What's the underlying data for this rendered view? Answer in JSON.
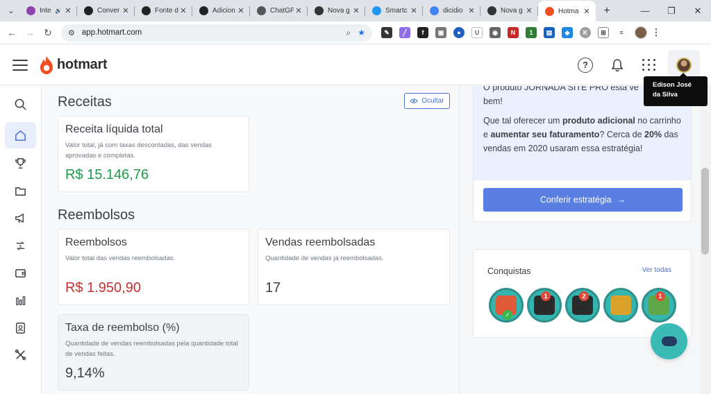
{
  "browser": {
    "tabs": [
      {
        "label": "Inte",
        "favicon": "heart",
        "color": "#8e44ad",
        "has_audio": true
      },
      {
        "label": "Conver",
        "favicon": "openai",
        "color": "#222222"
      },
      {
        "label": "Fonte d",
        "favicon": "openai",
        "color": "#222222"
      },
      {
        "label": "Adicion",
        "favicon": "openai",
        "color": "#222222"
      },
      {
        "label": "ChatGP",
        "favicon": "openai",
        "color": "#555555"
      },
      {
        "label": "Nova g",
        "favicon": "github",
        "color": "#333333"
      },
      {
        "label": "Smartc",
        "favicon": "smart",
        "color": "#2196f3"
      },
      {
        "label": "dicidio",
        "favicon": "google",
        "color": "#4285f4"
      },
      {
        "label": "Nova g",
        "favicon": "github",
        "color": "#333333"
      },
      {
        "label": "Hotma",
        "favicon": "hotmart",
        "color": "#f04e23",
        "active": true
      }
    ],
    "url": "app.hotmart.com"
  },
  "header": {
    "brand": "hotmart",
    "tooltip": "Edison José da Silva"
  },
  "sidebar": {
    "items": [
      "search",
      "home",
      "trophy",
      "folder",
      "megaphone",
      "money",
      "wallet",
      "chart",
      "contact",
      "tools"
    ]
  },
  "receitas": {
    "title": "Receitas",
    "hide_button": "Ocultar",
    "card": {
      "title": "Receita líquida total",
      "desc": "Valor total, já com taxas descontadas, das vendas aprovadas e completas.",
      "value": "R$ 15.146,76"
    }
  },
  "reembolsos": {
    "title": "Reembolsos",
    "cards": [
      {
        "title": "Reembolsos",
        "desc": "Valor total das vendas reembolsadas.",
        "value": "R$ 1.950,90"
      },
      {
        "title": "Vendas reembolsadas",
        "desc": "Quantidade de vendas já reembolsadas.",
        "value": "17"
      },
      {
        "title": "Taxa de reembolso (%)",
        "desc": "Quantidade de vendas reembolsadas pela quantidade total de vendas feitas.",
        "value": "9,14%"
      }
    ]
  },
  "promo": {
    "cut_line1": "O produto JORNADA SITE PRO está ve",
    "cut_line2": "bem!",
    "body_1": "Que tal oferecer um ",
    "body_b1": "produto adicional",
    "body_2": " no carrinho e ",
    "body_b2": "aumentar seu faturamento",
    "body_3": "? Cerca de ",
    "body_b3": "20%",
    "body_4": " das vendas em 2020 usaram essa estratégia!",
    "cta": "Conferir estratégia"
  },
  "achievements": {
    "title": "Conquistas",
    "see_all": "Ver todas",
    "badges": [
      {
        "kind": "certificate",
        "num": "",
        "check": true
      },
      {
        "kind": "cart",
        "num": "1",
        "check": false
      },
      {
        "kind": "cart",
        "num": "2",
        "check": false
      },
      {
        "kind": "trophy",
        "num": "",
        "check": false
      },
      {
        "kind": "cash",
        "num": "1",
        "check": false
      }
    ]
  }
}
